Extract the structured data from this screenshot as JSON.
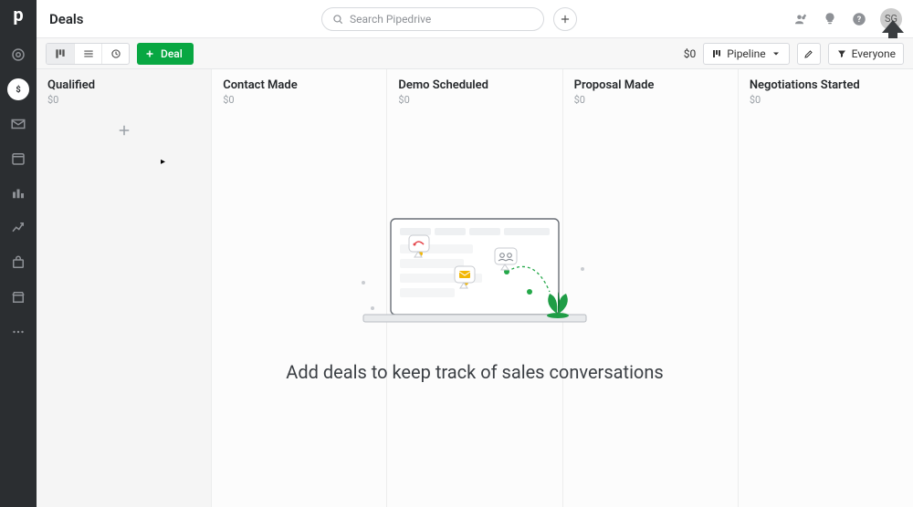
{
  "header": {
    "title": "Deals",
    "search_placeholder": "Search Pipedrive",
    "avatar_initials": "SG"
  },
  "toolbar": {
    "deal_button_label": "Deal",
    "sum_label": "$0",
    "pipeline_button_label": "Pipeline",
    "filter_button_label": "Everyone"
  },
  "columns": [
    {
      "title": "Qualified",
      "amount": "$0",
      "show_add": true
    },
    {
      "title": "Contact Made",
      "amount": "$0",
      "show_add": false
    },
    {
      "title": "Demo Scheduled",
      "amount": "$0",
      "show_add": false
    },
    {
      "title": "Proposal Made",
      "amount": "$0",
      "show_add": false
    },
    {
      "title": "Negotiations Started",
      "amount": "$0",
      "show_add": false
    }
  ],
  "empty_state": {
    "heading": "Add deals to keep track of sales conversations"
  }
}
